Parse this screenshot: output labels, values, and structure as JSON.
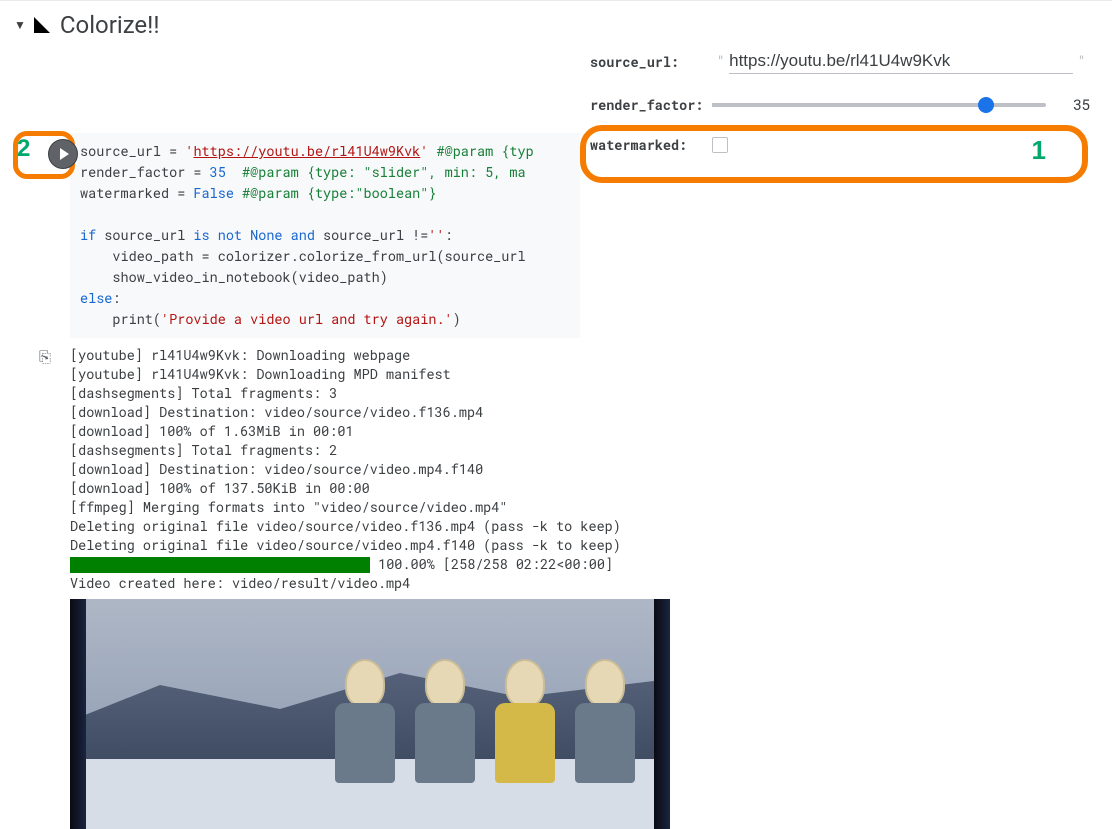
{
  "header": {
    "title": "Colorize!!"
  },
  "annotations": {
    "marker_1": "1",
    "marker_2": "2"
  },
  "code": {
    "l1a": "source_url = ",
    "l1b": "'",
    "l1c": "https://youtu.be/rl41U4w9Kvk",
    "l1d": "'",
    "l1e": " #@param {typ",
    "l2a": "render_factor = ",
    "l2b": "35",
    "l2c": "  #@param {type: \"slider\", min: 5, ma",
    "l3a": "watermarked = ",
    "l3b": "False",
    "l3c": " #@param {type:\"boolean\"}",
    "l5a": "if",
    "l5b": " source_url ",
    "l5c": "is not None and",
    "l5d": " source_url !=",
    "l5e": "''",
    "l5f": ":",
    "l6a": "    video_path = colorizer.colorize_from_url(source_url",
    "l7a": "    show_video_in_notebook(video_path)",
    "l8a": "else",
    "l8b": ":",
    "l9a": "    print(",
    "l9b": "'Provide a video url and try again.'",
    "l9c": ")"
  },
  "output": {
    "l1": "[youtube] rl41U4w9Kvk: Downloading webpage",
    "l2": "[youtube] rl41U4w9Kvk: Downloading MPD manifest",
    "l3": "[dashsegments] Total fragments: 3",
    "l4": "[download] Destination: video/source/video.f136.mp4",
    "l5": "[download] 100% of 1.63MiB in 00:01",
    "l6": "[dashsegments] Total fragments: 2",
    "l7": "[download] Destination: video/source/video.mp4.f140",
    "l8": "[download] 100% of 137.50KiB in 00:00",
    "l9": "[ffmpeg] Merging formats into \"video/source/video.mp4\"",
    "l10": "Deleting original file video/source/video.f136.mp4 (pass -k to keep)",
    "l11": "Deleting original file video/source/video.mp4.f140 (pass -k to keep)",
    "progress_text": " 100.00% [258/258 02:22<00:00]",
    "l12": "Video created here: video/result/video.mp4"
  },
  "form": {
    "source_url": {
      "label": "source_url:",
      "value": "https://youtu.be/rl41U4w9Kvk"
    },
    "render_factor": {
      "label": "render_factor:",
      "value": 35,
      "min": 5,
      "max": 40,
      "percent": 82
    },
    "watermarked": {
      "label": "watermarked:",
      "value": false
    }
  }
}
